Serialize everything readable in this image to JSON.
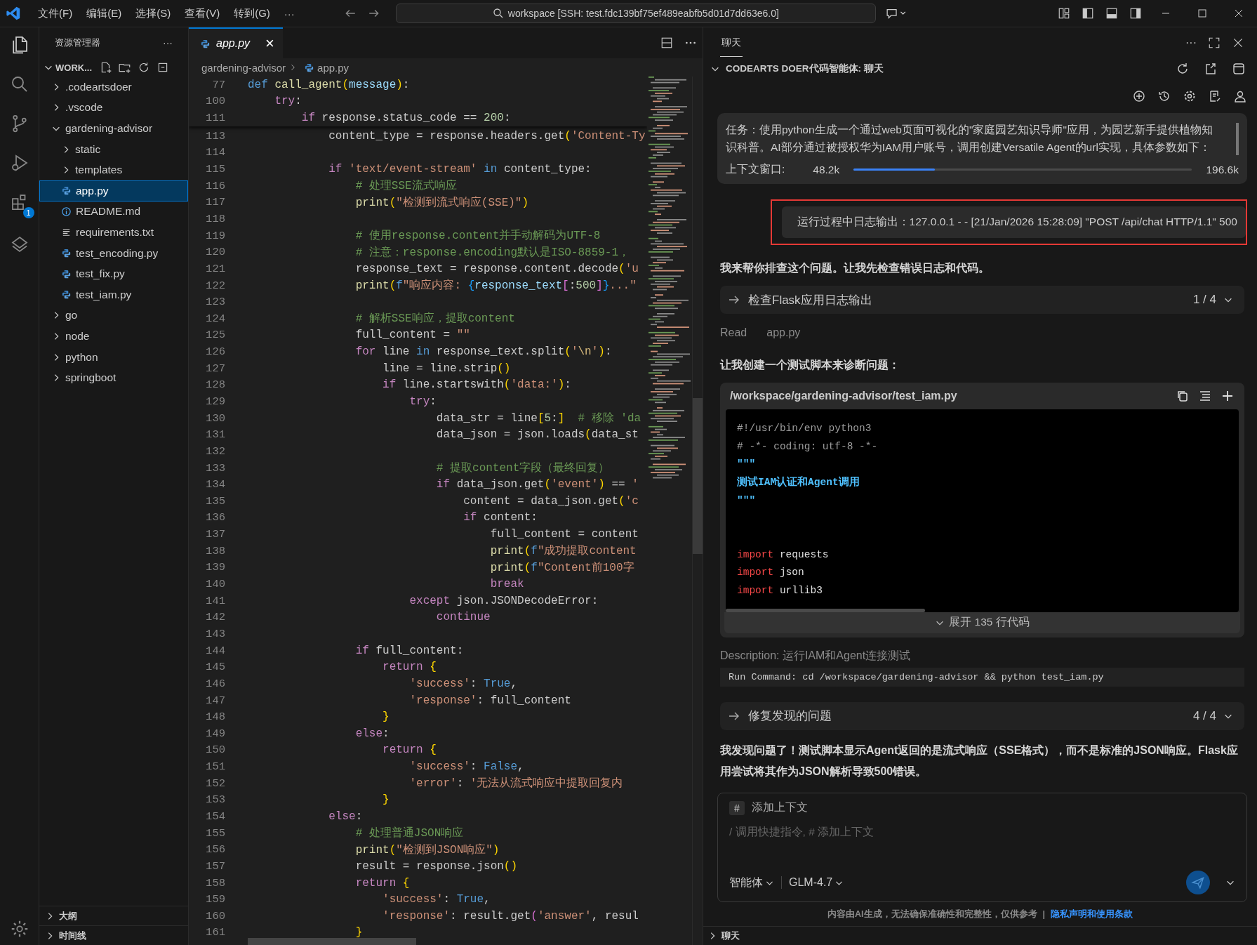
{
  "title_bar": {
    "menus": [
      "文件(F)",
      "编辑(E)",
      "选择(S)",
      "查看(V)",
      "转到(G)"
    ],
    "more": "···",
    "search": "workspace [SSH: test.fdc139bf75ef489eabfb5d01d7dd63e6.0]"
  },
  "activity_bar": {
    "badge": "1"
  },
  "explorer": {
    "title": "资源管理器",
    "more": "···",
    "root": "WORK...",
    "tree": [
      {
        "name": ".codeartsdoer",
        "kind": "folder",
        "expanded": false,
        "selected": false
      },
      {
        "name": ".vscode",
        "kind": "folder",
        "expanded": false,
        "selected": false
      },
      {
        "name": "gardening-advisor",
        "kind": "folder",
        "expanded": true,
        "selected": false,
        "children": [
          {
            "name": "static",
            "kind": "folder",
            "expanded": false,
            "selected": false
          },
          {
            "name": "templates",
            "kind": "folder",
            "expanded": false,
            "selected": false
          },
          {
            "name": "app.py",
            "kind": "python",
            "selected": true
          },
          {
            "name": "README.md",
            "kind": "info",
            "selected": false
          },
          {
            "name": "requirements.txt",
            "kind": "text",
            "selected": false
          },
          {
            "name": "test_encoding.py",
            "kind": "python",
            "selected": false
          },
          {
            "name": "test_fix.py",
            "kind": "python",
            "selected": false
          },
          {
            "name": "test_iam.py",
            "kind": "python",
            "selected": false
          }
        ]
      },
      {
        "name": "go",
        "kind": "folder",
        "expanded": false,
        "selected": false
      },
      {
        "name": "node",
        "kind": "folder",
        "expanded": false,
        "selected": false
      },
      {
        "name": "python",
        "kind": "folder",
        "expanded": false,
        "selected": false
      },
      {
        "name": "springboot",
        "kind": "folder",
        "expanded": false,
        "selected": false
      }
    ],
    "sections": [
      {
        "label": "大纲",
        "expanded": false
      },
      {
        "label": "时间线",
        "expanded": false
      }
    ]
  },
  "editor": {
    "tab": {
      "label": "app.py",
      "close": "×"
    },
    "breadcrumbs": [
      "gardening-advisor",
      "app.py"
    ],
    "sticky_lines": [
      {
        "number": "77",
        "tokens": [
          {
            "text": "def ",
            "kind": "kw"
          },
          {
            "text": "call_agent",
            "kind": "fn"
          },
          {
            "text": "(",
            "kind": "br1"
          },
          {
            "text": "message",
            "kind": "param"
          },
          {
            "text": ")",
            "kind": "br1"
          },
          {
            "text": ":",
            "kind": "plain"
          }
        ]
      },
      {
        "number": "100",
        "tokens": [
          {
            "text": "    try",
            "kind": "ctrl"
          },
          {
            "text": ":",
            "kind": "plain"
          }
        ]
      },
      {
        "number": "111",
        "tokens": [
          {
            "text": "        if",
            "kind": "ctrl"
          },
          {
            "text": " response.status_code == ",
            "kind": "plain"
          },
          {
            "text": "200",
            "kind": "num"
          },
          {
            "text": ":",
            "kind": "plain"
          }
        ]
      }
    ],
    "lines": [
      {
        "number": "113",
        "tokens": [
          {
            "text": "            content_type = response.headers.get",
            "kind": "plain"
          },
          {
            "text": "(",
            "kind": "br1"
          },
          {
            "text": "'Content-Ty",
            "kind": "str"
          }
        ]
      },
      {
        "number": "114"
      },
      {
        "number": "115",
        "tokens": [
          {
            "text": "            if ",
            "kind": "ctrl"
          },
          {
            "text": "'text/event-stream'",
            "kind": "str"
          },
          {
            "text": " in",
            "kind": "kw"
          },
          {
            "text": " content_type:",
            "kind": "plain"
          }
        ]
      },
      {
        "number": "116",
        "tokens": [
          {
            "text": "                # 处理SSE流式响应",
            "kind": "cmt"
          }
        ]
      },
      {
        "number": "117",
        "tokens": [
          {
            "text": "                print",
            "kind": "fn"
          },
          {
            "text": "(",
            "kind": "br1"
          },
          {
            "text": "\"检测到流式响应(SSE)\"",
            "kind": "str"
          },
          {
            "text": ")",
            "kind": "br1"
          }
        ]
      },
      {
        "number": "118"
      },
      {
        "number": "119",
        "tokens": [
          {
            "text": "                # 使用response.content并手动解码为UTF-8",
            "kind": "cmt"
          }
        ]
      },
      {
        "number": "120",
        "tokens": [
          {
            "text": "                # 注意：response.encoding默认是ISO-8859-1，",
            "kind": "cmt"
          }
        ]
      },
      {
        "number": "121",
        "tokens": [
          {
            "text": "                response_text = response.content.decode",
            "kind": "plain"
          },
          {
            "text": "(",
            "kind": "br1"
          },
          {
            "text": "'u",
            "kind": "str"
          }
        ]
      },
      {
        "number": "122",
        "tokens": [
          {
            "text": "                print",
            "kind": "fn"
          },
          {
            "text": "(",
            "kind": "br1"
          },
          {
            "text": "f",
            "kind": "kw"
          },
          {
            "text": "\"响应内容: ",
            "kind": "str"
          },
          {
            "text": "{",
            "kind": "br3"
          },
          {
            "text": "response_text",
            "kind": "param"
          },
          {
            "text": "[",
            "kind": "br2"
          },
          {
            "text": ":",
            "kind": "plain"
          },
          {
            "text": "500",
            "kind": "num"
          },
          {
            "text": "]",
            "kind": "br2"
          },
          {
            "text": "}",
            "kind": "br3"
          },
          {
            "text": "...\"",
            "kind": "str"
          }
        ]
      },
      {
        "number": "123"
      },
      {
        "number": "124",
        "tokens": [
          {
            "text": "                # 解析SSE响应，提取content",
            "kind": "cmt"
          }
        ]
      },
      {
        "number": "125",
        "tokens": [
          {
            "text": "                full_content = ",
            "kind": "plain"
          },
          {
            "text": "\"\"",
            "kind": "str"
          }
        ]
      },
      {
        "number": "126",
        "tokens": [
          {
            "text": "                for",
            "kind": "ctrl"
          },
          {
            "text": " line ",
            "kind": "plain"
          },
          {
            "text": "in",
            "kind": "kw"
          },
          {
            "text": " response_text.split",
            "kind": "plain"
          },
          {
            "text": "(",
            "kind": "br1"
          },
          {
            "text": "'",
            "kind": "str"
          },
          {
            "text": "\\n",
            "kind": "esc"
          },
          {
            "text": "'",
            "kind": "str"
          },
          {
            "text": ")",
            "kind": "br1"
          },
          {
            "text": ":",
            "kind": "plain"
          }
        ]
      },
      {
        "number": "127",
        "tokens": [
          {
            "text": "                    line = line.strip",
            "kind": "plain"
          },
          {
            "text": "()",
            "kind": "br1"
          }
        ]
      },
      {
        "number": "128",
        "tokens": [
          {
            "text": "                    if",
            "kind": "ctrl"
          },
          {
            "text": " line.startswith",
            "kind": "plain"
          },
          {
            "text": "(",
            "kind": "br1"
          },
          {
            "text": "'data:'",
            "kind": "str"
          },
          {
            "text": ")",
            "kind": "br1"
          },
          {
            "text": ":",
            "kind": "plain"
          }
        ]
      },
      {
        "number": "129",
        "tokens": [
          {
            "text": "                        try",
            "kind": "ctrl"
          },
          {
            "text": ":",
            "kind": "plain"
          }
        ]
      },
      {
        "number": "130",
        "tokens": [
          {
            "text": "                            data_str = line",
            "kind": "plain"
          },
          {
            "text": "[",
            "kind": "br1"
          },
          {
            "text": "5",
            "kind": "num"
          },
          {
            "text": ":",
            "kind": "plain"
          },
          {
            "text": "]",
            "kind": "br1"
          },
          {
            "text": "  # 移除 'da",
            "kind": "cmt"
          }
        ]
      },
      {
        "number": "131",
        "tokens": [
          {
            "text": "                            data_json = json.loads",
            "kind": "plain"
          },
          {
            "text": "(",
            "kind": "br1"
          },
          {
            "text": "data_st",
            "kind": "plain"
          }
        ]
      },
      {
        "number": "132"
      },
      {
        "number": "133",
        "tokens": [
          {
            "text": "                            # 提取content字段（最终回复）",
            "kind": "cmt"
          }
        ]
      },
      {
        "number": "134",
        "tokens": [
          {
            "text": "                            if",
            "kind": "ctrl"
          },
          {
            "text": " data_json.get",
            "kind": "plain"
          },
          {
            "text": "(",
            "kind": "br1"
          },
          {
            "text": "'event'",
            "kind": "str"
          },
          {
            "text": ")",
            "kind": "br1"
          },
          {
            "text": " == ",
            "kind": "plain"
          },
          {
            "text": "'",
            "kind": "str"
          }
        ]
      },
      {
        "number": "135",
        "tokens": [
          {
            "text": "                                content = data_json.get",
            "kind": "plain"
          },
          {
            "text": "(",
            "kind": "br1"
          },
          {
            "text": "'c",
            "kind": "str"
          }
        ]
      },
      {
        "number": "136",
        "tokens": [
          {
            "text": "                                if",
            "kind": "ctrl"
          },
          {
            "text": " content:",
            "kind": "plain"
          }
        ]
      },
      {
        "number": "137",
        "tokens": [
          {
            "text": "                                    full_content = content",
            "kind": "plain"
          }
        ]
      },
      {
        "number": "138",
        "tokens": [
          {
            "text": "                                    print",
            "kind": "fn"
          },
          {
            "text": "(",
            "kind": "br1"
          },
          {
            "text": "f",
            "kind": "kw"
          },
          {
            "text": "\"成功提取content",
            "kind": "str"
          }
        ]
      },
      {
        "number": "139",
        "tokens": [
          {
            "text": "                                    print",
            "kind": "fn"
          },
          {
            "text": "(",
            "kind": "br1"
          },
          {
            "text": "f",
            "kind": "kw"
          },
          {
            "text": "\"Content前100字",
            "kind": "str"
          }
        ]
      },
      {
        "number": "140",
        "tokens": [
          {
            "text": "                                    break",
            "kind": "ctrl"
          }
        ]
      },
      {
        "number": "141",
        "tokens": [
          {
            "text": "                        except",
            "kind": "ctrl"
          },
          {
            "text": " json.JSONDecodeError:",
            "kind": "plain"
          }
        ]
      },
      {
        "number": "142",
        "tokens": [
          {
            "text": "                            continue",
            "kind": "ctrl"
          }
        ]
      },
      {
        "number": "143"
      },
      {
        "number": "144",
        "tokens": [
          {
            "text": "                if",
            "kind": "ctrl"
          },
          {
            "text": " full_content:",
            "kind": "plain"
          }
        ]
      },
      {
        "number": "145",
        "tokens": [
          {
            "text": "                    return ",
            "kind": "ctrl"
          },
          {
            "text": "{",
            "kind": "br1"
          }
        ]
      },
      {
        "number": "146",
        "tokens": [
          {
            "text": "                        'success'",
            "kind": "str"
          },
          {
            "text": ": ",
            "kind": "plain"
          },
          {
            "text": "True",
            "kind": "kw"
          },
          {
            "text": ",",
            "kind": "plain"
          }
        ]
      },
      {
        "number": "147",
        "tokens": [
          {
            "text": "                        'response'",
            "kind": "str"
          },
          {
            "text": ": full_content",
            "kind": "plain"
          }
        ]
      },
      {
        "number": "148",
        "tokens": [
          {
            "text": "                    }",
            "kind": "br1"
          }
        ]
      },
      {
        "number": "149",
        "tokens": [
          {
            "text": "                else",
            "kind": "ctrl"
          },
          {
            "text": ":",
            "kind": "plain"
          }
        ]
      },
      {
        "number": "150",
        "tokens": [
          {
            "text": "                    return ",
            "kind": "ctrl"
          },
          {
            "text": "{",
            "kind": "br1"
          }
        ]
      },
      {
        "number": "151",
        "tokens": [
          {
            "text": "                        'success'",
            "kind": "str"
          },
          {
            "text": ": ",
            "kind": "plain"
          },
          {
            "text": "False",
            "kind": "kw"
          },
          {
            "text": ",",
            "kind": "plain"
          }
        ]
      },
      {
        "number": "152",
        "tokens": [
          {
            "text": "                        'error'",
            "kind": "str"
          },
          {
            "text": ": ",
            "kind": "plain"
          },
          {
            "text": "'无法从流式响应中提取回复内",
            "kind": "str"
          }
        ]
      },
      {
        "number": "153",
        "tokens": [
          {
            "text": "                    }",
            "kind": "br1"
          }
        ]
      },
      {
        "number": "154",
        "tokens": [
          {
            "text": "            else",
            "kind": "ctrl"
          },
          {
            "text": ":",
            "kind": "plain"
          }
        ]
      },
      {
        "number": "155",
        "tokens": [
          {
            "text": "                # 处理普通JSON响应",
            "kind": "cmt"
          }
        ]
      },
      {
        "number": "156",
        "tokens": [
          {
            "text": "                print",
            "kind": "fn"
          },
          {
            "text": "(",
            "kind": "br1"
          },
          {
            "text": "\"检测到JSON响应\"",
            "kind": "str"
          },
          {
            "text": ")",
            "kind": "br1"
          }
        ]
      },
      {
        "number": "157",
        "tokens": [
          {
            "text": "                result = response.json",
            "kind": "plain"
          },
          {
            "text": "()",
            "kind": "br1"
          }
        ]
      },
      {
        "number": "158",
        "tokens": [
          {
            "text": "                return ",
            "kind": "ctrl"
          },
          {
            "text": "{",
            "kind": "br1"
          }
        ]
      },
      {
        "number": "159",
        "tokens": [
          {
            "text": "                    'success'",
            "kind": "str"
          },
          {
            "text": ": ",
            "kind": "plain"
          },
          {
            "text": "True",
            "kind": "kw"
          },
          {
            "text": ",",
            "kind": "plain"
          }
        ]
      },
      {
        "number": "160",
        "tokens": [
          {
            "text": "                    'response'",
            "kind": "str"
          },
          {
            "text": ": result.get",
            "kind": "plain"
          },
          {
            "text": "(",
            "kind": "br2"
          },
          {
            "text": "'answer'",
            "kind": "str"
          },
          {
            "text": ", resul",
            "kind": "plain"
          }
        ]
      },
      {
        "number": "161",
        "tokens": [
          {
            "text": "                }",
            "kind": "br1"
          }
        ]
      }
    ]
  },
  "chat": {
    "tab": "聊天",
    "more": "···",
    "section_title": "CODEARTS DOER代码智能体: 聊天",
    "task": {
      "lines": [
        "任务：使用python生成一个通过web页面可视化的\"家庭园艺知识导师\"应用，为园艺新手提供植物知",
        "识科普。AI部分通过被授权华为IAM用户账号，调用创建Versatile Agent的url实现，具体参数如下："
      ]
    },
    "context": {
      "label": "上下文窗口:",
      "used": "48.2k",
      "level": 0.24,
      "total": "196.6k"
    },
    "messages": [
      {
        "kind": "user",
        "text": "运行过程中日志输出：127.0.0.1 - - [21/Jan/2026 15:28:09] \"POST /api/chat HTTP/1.1\" 500"
      },
      {
        "kind": "text",
        "text": "我来帮你排查这个问题。让我先检查错误日志和代码。"
      },
      {
        "kind": "step",
        "title": "检查Flask应用日志输出",
        "counter": "1 / 4"
      },
      {
        "kind": "read",
        "action": "Read",
        "file": "app.py"
      },
      {
        "kind": "text",
        "text": "让我创建一个测试脚本来诊断问题："
      },
      {
        "kind": "code",
        "path": "/workspace/gardening-advisor/test_iam.py",
        "lines": [
          {
            "kind": "code",
            "tokens": [
              {
                "text": "#!/usr/bin/env python3",
                "kind": "gray"
              }
            ]
          },
          {
            "kind": "code",
            "tokens": [
              {
                "text": "# -*- coding: utf-8 -*-",
                "kind": "gray"
              }
            ]
          },
          {
            "kind": "code",
            "tokens": [
              {
                "text": "\"\"\"",
                "kind": "doc"
              }
            ]
          },
          {
            "kind": "code",
            "tokens": [
              {
                "text": "测试IAM认证和Agent调用",
                "kind": "doc"
              }
            ]
          },
          {
            "kind": "code",
            "tokens": [
              {
                "text": "\"\"\"",
                "kind": "doc"
              }
            ]
          },
          {
            "kind": "blank"
          },
          {
            "kind": "blank"
          },
          {
            "kind": "code",
            "tokens": [
              {
                "text": "import",
                "kind": "imp"
              },
              {
                "text": " requests",
                "kind": "plain"
              }
            ]
          },
          {
            "kind": "code",
            "tokens": [
              {
                "text": "import",
                "kind": "imp"
              },
              {
                "text": " json",
                "kind": "plain"
              }
            ]
          },
          {
            "kind": "code",
            "tokens": [
              {
                "text": "import",
                "kind": "imp"
              },
              {
                "text": " urllib3",
                "kind": "plain"
              }
            ]
          }
        ],
        "expand": "展开 135 行代码"
      },
      {
        "kind": "command",
        "description": "Description: 运行IAM和Agent连接测试",
        "command": "Run Command: cd /workspace/gardening-advisor && python test_iam.py"
      },
      {
        "kind": "step",
        "title": "修复发现的问题",
        "counter": "4 / 4"
      },
      {
        "kind": "text",
        "text": "我发现问题了！测试脚本显示Agent返回的是**流式响应（SSE格式）**，而不是标准的JSON响应。Flask应用尝试将其作为JSON解析导致500错误。"
      }
    ],
    "input": {
      "chip": "#",
      "context": "添加上下文",
      "placeholder": "/ 调用快捷指令, # 添加上下文",
      "mode": "智能体",
      "model": "GLM-4.7"
    },
    "disclaimer": {
      "text": "内容由AI生成，无法确保准确性和完整性，仅供参考",
      "separator": "|",
      "link": "隐私声明和使用条款"
    },
    "bottom_section": "聊天"
  }
}
